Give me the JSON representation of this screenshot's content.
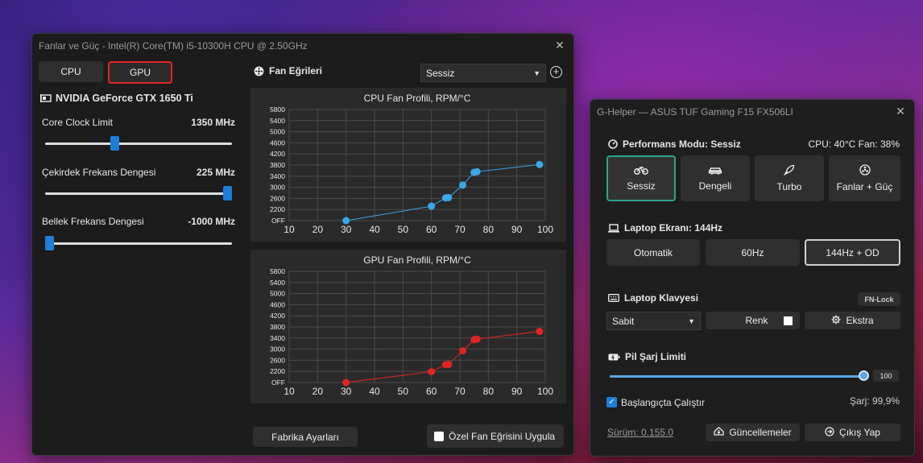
{
  "colors": {
    "accent": "#1e7fd8",
    "cpu_series": "#3ba7e6",
    "gpu_series": "#e02424",
    "mode_active_border": "#2aa58a"
  },
  "fan_window": {
    "title": "Fanlar ve Güç - Intel(R) Core(TM) i5-10300H CPU @ 2.50GHz",
    "tabs": [
      {
        "label": "CPU"
      },
      {
        "label": "GPU",
        "selected": true
      }
    ],
    "gpu_name": "NVIDIA GeForce GTX 1650 Ti",
    "sliders": [
      {
        "label": "Core Clock Limit",
        "value_text": "1350 MHz",
        "level": 0.4
      },
      {
        "label": "Çekirdek Frekans Dengesi",
        "value_text": "225 MHz",
        "level": 1.0
      },
      {
        "label": "Bellek Frekans Dengesi",
        "value_text": "-1000 MHz",
        "level": 0.0
      }
    ],
    "fan_curves_label": "Fan Eğrileri",
    "profile_select": "Sessiz",
    "factory_button": "Fabrika Ayarları",
    "custom_curve_checkbox": "Özel Fan Eğrisini Uygula"
  },
  "chart_data": [
    {
      "type": "line",
      "title": "CPU Fan Profili, RPM/°C",
      "x_ticks": [
        "10",
        "20",
        "30",
        "40",
        "50",
        "60",
        "70",
        "80",
        "90",
        "100"
      ],
      "y_ticks": [
        "OFF",
        "2200",
        "2600",
        "3000",
        "3400",
        "3800",
        "4200",
        "4600",
        "5000",
        "5400",
        "5800"
      ],
      "xlim": [
        10,
        100
      ],
      "series": [
        {
          "x": [
            30,
            60,
            65,
            66,
            71,
            75,
            76,
            98
          ],
          "y": [
            0,
            2320,
            2620,
            2630,
            3080,
            3540,
            3560,
            3820
          ]
        }
      ]
    },
    {
      "type": "line",
      "title": "GPU Fan Profili, RPM/°C",
      "x_ticks": [
        "10",
        "20",
        "30",
        "40",
        "50",
        "60",
        "70",
        "80",
        "90",
        "100"
      ],
      "y_ticks": [
        "OFF",
        "2200",
        "2600",
        "3000",
        "3400",
        "3800",
        "4200",
        "4600",
        "5000",
        "5400",
        "5800"
      ],
      "xlim": [
        10,
        100
      ],
      "series": [
        {
          "x": [
            30,
            60,
            65,
            66,
            71,
            75,
            76,
            98
          ],
          "y": [
            0,
            2140,
            2440,
            2450,
            2940,
            3340,
            3360,
            3640
          ]
        }
      ]
    }
  ],
  "ghelper": {
    "title": "G-Helper — ASUS TUF Gaming F15 FX506LI",
    "perf_heading": "Performans Modu: Sessiz",
    "perf_status": "CPU: 40°C Fan: 38%",
    "modes": [
      {
        "label": "Sessiz",
        "icon": "bicycle-icon"
      },
      {
        "label": "Dengeli",
        "icon": "car-icon"
      },
      {
        "label": "Turbo",
        "icon": "rocket-icon"
      },
      {
        "label": "Fanlar + Güç",
        "icon": "fan-icon"
      }
    ],
    "screen_heading": "Laptop Ekranı: 144Hz",
    "screen_modes": [
      "Otomatik",
      "60Hz",
      "144Hz + OD"
    ],
    "keyboard_heading": "Laptop Klavyesi",
    "fn_lock": "FN-Lock",
    "keyboard_mode": "Sabit",
    "color_button": "Renk",
    "extra_button": "Ekstra",
    "battery_heading": "Pil Şarj Limiti",
    "battery_value": "100",
    "battery_level": 1.0,
    "startup_label": "Başlangıçta Çalıştır",
    "charge_status": "Şarj: 99,9%",
    "version": "Sürüm: 0.155.0",
    "updates_button": "Güncellemeler",
    "exit_button": "Çıkış Yap"
  }
}
